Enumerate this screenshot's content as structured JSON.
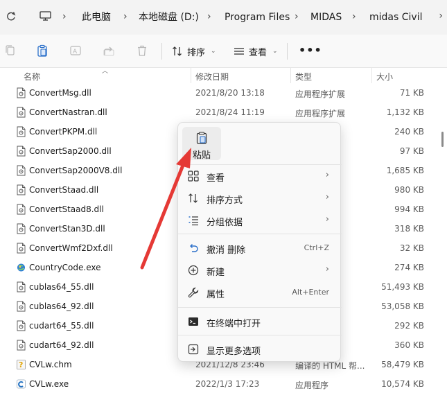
{
  "address_bar": {
    "breadcrumbs": [
      "此电脑",
      "本地磁盘 (D:)",
      "Program Files",
      "MIDAS",
      "midas Civil"
    ]
  },
  "toolbar": {
    "sort_label": "排序",
    "view_label": "查看",
    "more_label": "•••"
  },
  "columns": {
    "name": "名称",
    "date": "修改日期",
    "type": "类型",
    "size": "大小"
  },
  "files": [
    {
      "name": "ConvertMsg.dll",
      "date": "2021/8/20 13:18",
      "type": "应用程序扩展",
      "size": "71 KB",
      "icon": "dll-file-icon"
    },
    {
      "name": "ConvertNastran.dll",
      "date": "2021/8/24 11:19",
      "type": "应用程序扩展",
      "size": "1,132 KB",
      "icon": "dll-file-icon"
    },
    {
      "name": "ConvertPKPM.dll",
      "date": "",
      "type": "",
      "size": "240 KB",
      "icon": "dll-file-icon"
    },
    {
      "name": "ConvertSap2000.dll",
      "date": "",
      "type": "",
      "size": "97 KB",
      "icon": "dll-file-icon"
    },
    {
      "name": "ConvertSap2000V8.dll",
      "date": "",
      "type": "",
      "size": "1,685 KB",
      "icon": "dll-file-icon"
    },
    {
      "name": "ConvertStaad.dll",
      "date": "",
      "type": "",
      "size": "980 KB",
      "icon": "dll-file-icon"
    },
    {
      "name": "ConvertStaad8.dll",
      "date": "",
      "type": "",
      "size": "994 KB",
      "icon": "dll-file-icon"
    },
    {
      "name": "ConvertStan3D.dll",
      "date": "",
      "type": "",
      "size": "318 KB",
      "icon": "dll-file-icon"
    },
    {
      "name": "ConvertWmf2Dxf.dll",
      "date": "",
      "type": "",
      "size": "32 KB",
      "icon": "dll-file-icon"
    },
    {
      "name": "CountryCode.exe",
      "date": "",
      "type": "",
      "size": "274 KB",
      "icon": "exe-globe-icon"
    },
    {
      "name": "cublas64_55.dll",
      "date": "",
      "type": "",
      "size": "51,493 KB",
      "icon": "dll-file-icon"
    },
    {
      "name": "cublas64_92.dll",
      "date": "",
      "type": "",
      "size": "53,058 KB",
      "icon": "dll-file-icon"
    },
    {
      "name": "cudart64_55.dll",
      "date": "",
      "type": "",
      "size": "292 KB",
      "icon": "dll-file-icon"
    },
    {
      "name": "cudart64_92.dll",
      "date": "",
      "type": "",
      "size": "360 KB",
      "icon": "dll-file-icon"
    },
    {
      "name": "CVLw.chm",
      "date": "2021/12/8 23:46",
      "type": "编译的 HTML 帮...",
      "size": "58,479 KB",
      "icon": "chm-help-icon"
    },
    {
      "name": "CVLw.exe",
      "date": "2022/1/3 17:23",
      "type": "应用程序",
      "size": "10,574 KB",
      "icon": "exe-app-icon"
    }
  ],
  "context_menu": {
    "paste_label": "粘贴",
    "items": [
      {
        "label": "查看",
        "shortcut": "",
        "submenu": true,
        "icon": "grid-view-icon"
      },
      {
        "label": "排序方式",
        "shortcut": "",
        "submenu": true,
        "icon": "sort-icon"
      },
      {
        "label": "分组依据",
        "shortcut": "",
        "submenu": true,
        "icon": "group-icon"
      },
      {
        "label": "撤消 删除",
        "shortcut": "Ctrl+Z",
        "submenu": false,
        "icon": "undo-icon"
      },
      {
        "label": "新建",
        "shortcut": "",
        "submenu": true,
        "icon": "new-plus-icon"
      },
      {
        "label": "属性",
        "shortcut": "Alt+Enter",
        "submenu": false,
        "icon": "wrench-icon"
      },
      {
        "label": "在终端中打开",
        "shortcut": "",
        "submenu": false,
        "icon": "terminal-icon"
      },
      {
        "label": "显示更多选项",
        "shortcut": "",
        "submenu": false,
        "icon": "more-options-icon"
      }
    ]
  },
  "colors": {
    "annotation_arrow": "#e53935",
    "accent": "#0067c0"
  }
}
